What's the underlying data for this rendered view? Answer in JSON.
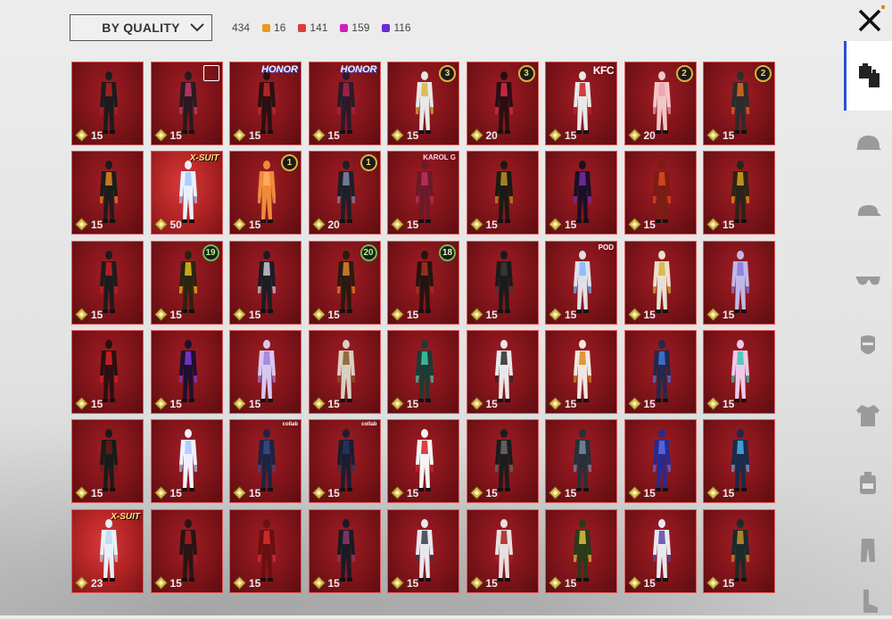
{
  "sort": {
    "label": "BY QUALITY"
  },
  "summary": {
    "total": "434",
    "qualities": [
      {
        "count": "16",
        "color": "#e59c22"
      },
      {
        "count": "141",
        "color": "#e03b3b"
      },
      {
        "count": "159",
        "color": "#d01fb8"
      },
      {
        "count": "116",
        "color": "#6a2bd8"
      }
    ]
  },
  "colors": {
    "accent": "#2a4fd8",
    "card": "#8c171c",
    "card_border": "#e05a5a",
    "gold": "#d8b43b"
  },
  "sidebar": {
    "categories": [
      {
        "icon": "outfit-icon",
        "active": true
      },
      {
        "icon": "helmet-icon",
        "active": false
      },
      {
        "icon": "cap-icon",
        "active": false
      },
      {
        "icon": "glasses-icon",
        "active": false
      },
      {
        "icon": "mask-icon",
        "active": false
      },
      {
        "icon": "jacket-icon",
        "active": false
      },
      {
        "icon": "backpack-icon",
        "active": false
      },
      {
        "icon": "pants-icon",
        "active": false
      },
      {
        "icon": "shoes-icon",
        "active": false
      }
    ]
  },
  "items": [
    {
      "count": "15",
      "tag": "",
      "tint": "#1c1c1c",
      "accent": "#b31e1e"
    },
    {
      "count": "15",
      "tag": "",
      "tint": "#2a1a1f",
      "accent": "#c23a6b",
      "box": true
    },
    {
      "count": "15",
      "tag": "HONOR",
      "tint": "#2b1010",
      "accent": "#c82828"
    },
    {
      "count": "15",
      "tag": "HONOR",
      "tint": "#2b1a2a",
      "accent": "#b02048"
    },
    {
      "count": "15",
      "tag": "",
      "lvl": "3",
      "tint": "#e8e8e8",
      "accent": "#d8b43b"
    },
    {
      "count": "20",
      "tag": "",
      "lvl": "3",
      "tint": "#2a0e12",
      "accent": "#e0284a"
    },
    {
      "count": "15",
      "tag": "KFC",
      "tint": "#e8e8e8",
      "accent": "#cc1f1f"
    },
    {
      "count": "20",
      "tag": "",
      "lvl": "2",
      "tint": "#f2c6c6",
      "accent": "#f0a0b0"
    },
    {
      "count": "15",
      "tag": "",
      "lvl": "2",
      "tint": "#2c2c2c",
      "accent": "#e06a1e"
    },
    {
      "count": "15",
      "tag": "",
      "tint": "#1c1c1c",
      "accent": "#e08a1e"
    },
    {
      "count": "50",
      "tag": "X-SUIT",
      "xsuit": true,
      "tint": "#e8f0ff",
      "accent": "#a0c8ff"
    },
    {
      "count": "15",
      "tag": "",
      "lvl": "1",
      "tint": "#f08a3c",
      "accent": "#ffb060"
    },
    {
      "count": "20",
      "tag": "",
      "lvl": "1",
      "tint": "#1e1e28",
      "accent": "#7a8aa8"
    },
    {
      "count": "15",
      "tag": "KAROL G",
      "tint": "#6a1a28",
      "accent": "#c0305a"
    },
    {
      "count": "15",
      "tag": "",
      "tint": "#1a1a14",
      "accent": "#b8922a"
    },
    {
      "count": "15",
      "tag": "",
      "tint": "#1a1024",
      "accent": "#7a2aa8"
    },
    {
      "count": "15",
      "tag": "",
      "tint": "#7a1e12",
      "accent": "#e04a1e"
    },
    {
      "count": "15",
      "tag": "",
      "tint": "#2a2418",
      "accent": "#d8a21e"
    },
    {
      "count": "15",
      "tag": "",
      "tint": "#1c1c1c",
      "accent": "#c81e1e"
    },
    {
      "count": "15",
      "tag": "",
      "lvl": "19",
      "lvlClass": "green",
      "tint": "#2a2410",
      "accent": "#e0c01e"
    },
    {
      "count": "15",
      "tag": "",
      "tint": "#1c1c24",
      "accent": "#c8c8d8"
    },
    {
      "count": "15",
      "tag": "",
      "lvl": "20",
      "lvlClass": "green",
      "tint": "#2a1a10",
      "accent": "#e0842a"
    },
    {
      "count": "15",
      "tag": "",
      "lvl": "18",
      "lvlClass": "green-light",
      "tint": "#241410",
      "accent": "#a83020"
    },
    {
      "count": "15",
      "tag": "",
      "tint": "#1a1a1a",
      "accent": "#3a3a3a"
    },
    {
      "count": "15",
      "tag": "POD",
      "tint": "#e0e0e8",
      "accent": "#7ab8ff"
    },
    {
      "count": "15",
      "tag": "",
      "tint": "#e8e0d0",
      "accent": "#d8b43b"
    },
    {
      "count": "15",
      "tag": "",
      "tint": "#c0b8e8",
      "accent": "#8a7ad8"
    },
    {
      "count": "15",
      "tag": "",
      "tint": "#2a1010",
      "accent": "#d82020"
    },
    {
      "count": "15",
      "tag": "",
      "tint": "#1e1030",
      "accent": "#7a3ad8"
    },
    {
      "count": "15",
      "tag": "",
      "tint": "#d8c8f0",
      "accent": "#a080e0"
    },
    {
      "count": "15",
      "tag": "",
      "tint": "#d8d0c0",
      "accent": "#8a5a2a"
    },
    {
      "count": "15",
      "tag": "",
      "tint": "#1e3a34",
      "accent": "#40c8a8"
    },
    {
      "count": "15",
      "tag": "",
      "tint": "#e8e8e8",
      "accent": "#2a2a2a"
    },
    {
      "count": "15",
      "tag": "",
      "tint": "#f0e8e0",
      "accent": "#d88a1e"
    },
    {
      "count": "15",
      "tag": "",
      "tint": "#24284a",
      "accent": "#3a7ae0"
    },
    {
      "count": "15",
      "tag": "",
      "tint": "#f0c8e8",
      "accent": "#40c8b0"
    },
    {
      "count": "15",
      "tag": "",
      "tint": "#1a1a1a",
      "accent": "#6a1a1a"
    },
    {
      "count": "15",
      "tag": "",
      "tint": "#f0f0ff",
      "accent": "#a8c8ff"
    },
    {
      "count": "15",
      "tag": "collab",
      "tint": "#1e2444",
      "accent": "#3a4a8a"
    },
    {
      "count": "15",
      "tag": "collab",
      "tint": "#1a1e30",
      "accent": "#2a3460"
    },
    {
      "count": "15",
      "tag": "",
      "tint": "#f4f4f4",
      "accent": "#d82020"
    },
    {
      "count": "15",
      "tag": "",
      "tint": "#1c1c1c",
      "accent": "#6a6a6a"
    },
    {
      "count": "15",
      "tag": "",
      "tint": "#28303a",
      "accent": "#7a8aa0"
    },
    {
      "count": "15",
      "tag": "",
      "tint": "#2a2a8a",
      "accent": "#5a6ae8"
    },
    {
      "count": "15",
      "tag": "",
      "tint": "#1a2a4a",
      "accent": "#4ab0e8"
    },
    {
      "count": "23",
      "tag": "X-SUIT",
      "xsuit": true,
      "tint": "#e8f0f8",
      "accent": "#c0d8f0"
    },
    {
      "count": "15",
      "tag": "",
      "tint": "#2a1414",
      "accent": "#a81e1e"
    },
    {
      "count": "15",
      "tag": "",
      "tint": "#6a1010",
      "accent": "#e02a2a"
    },
    {
      "count": "15",
      "tag": "",
      "tint": "#1a1a24",
      "accent": "#8a3a6a"
    },
    {
      "count": "15",
      "tag": "",
      "tint": "#e8e8f0",
      "accent": "#3a3a4a"
    },
    {
      "count": "15",
      "tag": "",
      "tint": "#e8e0e0",
      "accent": "#a82020"
    },
    {
      "count": "15",
      "tag": "",
      "tint": "#2a3a1a",
      "accent": "#d8c040"
    },
    {
      "count": "15",
      "tag": "",
      "tint": "#e8e8f0",
      "accent": "#5a4aa8"
    },
    {
      "count": "15",
      "tag": "",
      "tint": "#1a2a2a",
      "accent": "#c8902a"
    }
  ]
}
